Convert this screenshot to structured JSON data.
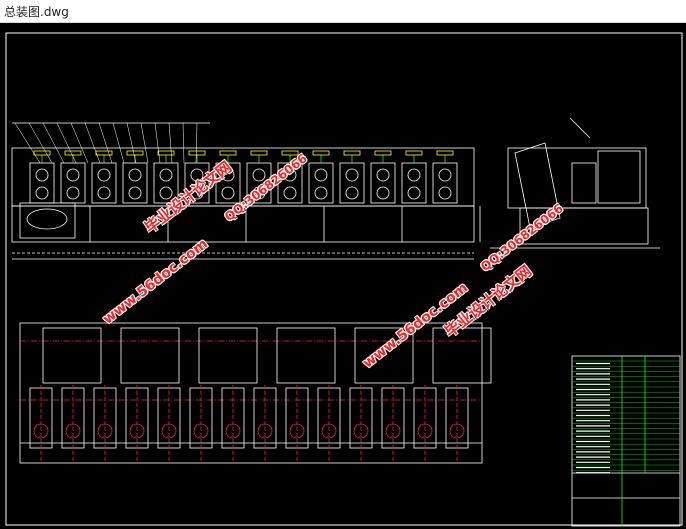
{
  "window": {
    "title": "总装图.dwg"
  },
  "watermarks": [
    {
      "id": "wm1",
      "text": "毕业设计论文网"
    },
    {
      "id": "wm2",
      "text": "www.56doc.com"
    },
    {
      "id": "wm3",
      "text": "QQ:306826066"
    },
    {
      "id": "wm4",
      "text": "毕业设计论文网"
    },
    {
      "id": "wm5",
      "text": "www.56doc.com"
    },
    {
      "id": "wm6",
      "text": "QQ:306826066"
    }
  ],
  "colors": {
    "background": "#000000",
    "lines": "#ffffff",
    "accent_red": "#ff2020",
    "accent_green": "#00ff00",
    "accent_yellow": "#ffff00"
  }
}
